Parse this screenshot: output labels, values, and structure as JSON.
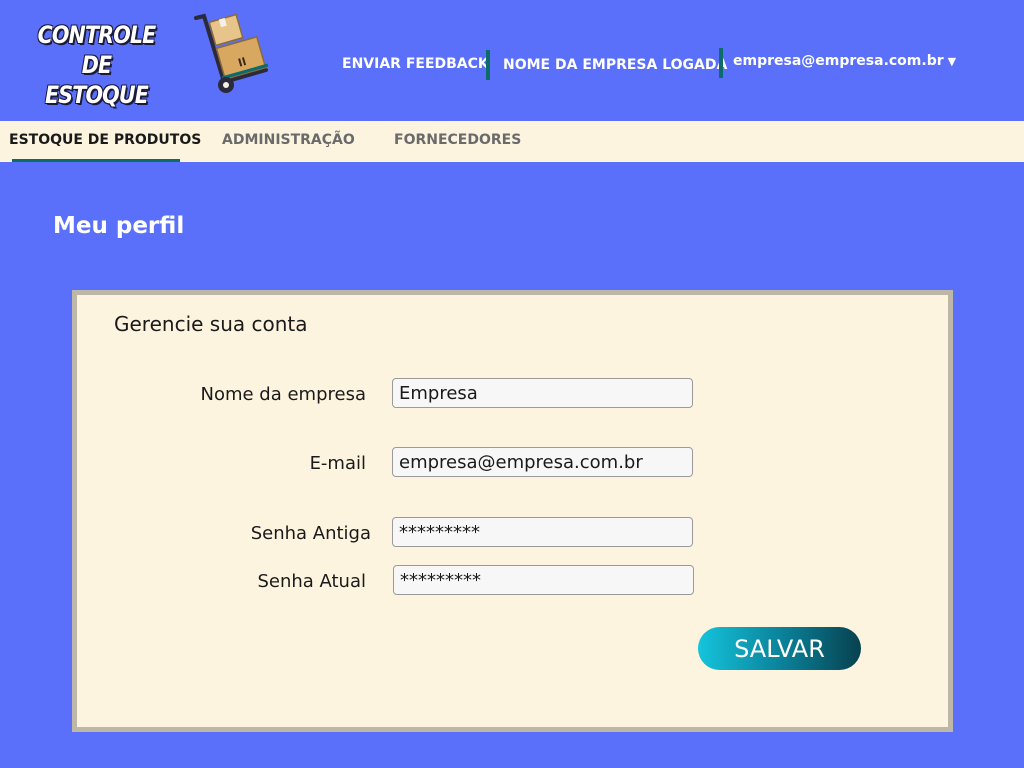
{
  "header": {
    "logo_line1": "CONTROLE DE",
    "logo_line2": "ESTOQUE",
    "feedback_link": "ENVIAR FEEDBACK",
    "company_link": "NOME DA EMPRESA LOGADA",
    "account_email": "empresa@empresa.com.br",
    "account_caret_icon": "caret-down-icon"
  },
  "tabs": [
    {
      "label": "ESTOQUE DE PRODUTOS",
      "active": true
    },
    {
      "label": "ADMINISTRAÇÃO",
      "active": false
    },
    {
      "label": "FORNECEDORES",
      "active": false
    }
  ],
  "page": {
    "title": "Meu perfil"
  },
  "form": {
    "title": "Gerencie sua conta",
    "company_name_label": "Nome da empresa",
    "company_name_value": "Empresa",
    "email_label": "E-mail",
    "email_value": "empresa@empresa.com.br",
    "old_password_label": "Senha Antiga",
    "old_password_value": "*********",
    "new_password_label": "Senha Atual",
    "new_password_value": "*********",
    "save_label": "SALVAR"
  },
  "colors": {
    "background": "#5a70fb",
    "panel": "#fdf4e0",
    "accent": "#0d6b6b"
  }
}
